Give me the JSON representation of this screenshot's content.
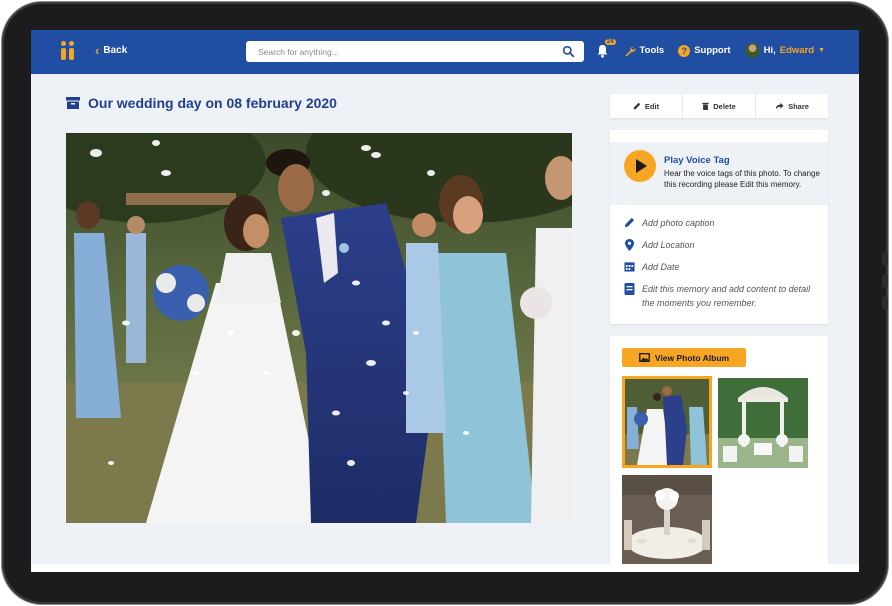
{
  "topbar": {
    "back_label": "Back",
    "search_placeholder": "Search for anything...",
    "notifications_count": "24",
    "tools_label": "Tools",
    "support_label": "Support",
    "greeting": "Hi,",
    "user_name": "Edward"
  },
  "memory": {
    "title": "Our wedding day on 08 february 2020"
  },
  "actions": {
    "edit_label": "Edit",
    "delete_label": "Delete",
    "share_label": "Share"
  },
  "voice": {
    "title": "Play Voice Tag",
    "description": "Hear the voice tags of this photo. To change this recording please Edit this memory."
  },
  "details": {
    "caption": "Add photo caption",
    "location": "Add Location",
    "date": "Add Date",
    "content": "Edit this memory and add content to detail the moments you remember."
  },
  "album": {
    "button_label": "View Photo Album"
  },
  "colors": {
    "brand_blue": "#1f4ea3",
    "accent_orange": "#f6a623",
    "title_blue": "#1f3f8f"
  }
}
